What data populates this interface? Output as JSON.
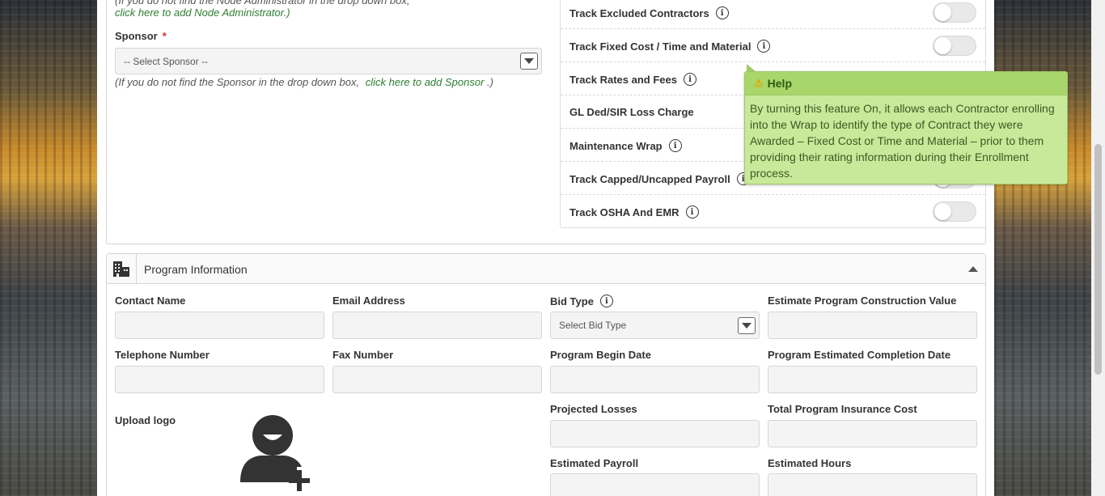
{
  "node_admin": {
    "note_partial": "(If you do not find the Node Administrator in the drop down box,",
    "link": "click here to add Node Administrator.)"
  },
  "sponsor": {
    "label": "Sponsor",
    "required_mark": "*",
    "select_value": "-- Select Sponsor --",
    "note_prefix": "(If you do not find the Sponsor in the drop down box,",
    "note_link": "click here to add Sponsor",
    "note_suffix": ".)"
  },
  "tracks": [
    {
      "label": "Track Excluded Contractors",
      "has_info": true,
      "toggle": "off"
    },
    {
      "label": "Track Fixed Cost / Time and Material",
      "has_info": true,
      "toggle": "off"
    },
    {
      "label": "Track Rates and Fees",
      "has_info": true
    },
    {
      "label": "GL Ded/SIR Loss Charge",
      "has_info": false
    },
    {
      "label": "Maintenance Wrap",
      "has_info": true
    },
    {
      "label": "Track Capped/Uncapped Payroll",
      "has_info": true,
      "toggle": "off"
    },
    {
      "label": "Track OSHA And EMR",
      "has_info": true,
      "toggle": "off"
    }
  ],
  "tooltip": {
    "title": "Help",
    "icon": "warning-icon",
    "body": "By turning this feature On, it allows each Contractor enrolling into the Wrap to identify the type of Contract they were Awarded – Fixed Cost or Time and Material – prior to them providing their rating information during their Enrollment process."
  },
  "program": {
    "title": "Program Information",
    "icon": "building-icon",
    "fields": {
      "contact_name": "Contact Name",
      "email_address": "Email Address",
      "bid_type": "Bid Type",
      "bid_type_placeholder": "Select Bid Type",
      "estimate_value": "Estimate Program Construction Value",
      "telephone": "Telephone Number",
      "fax": "Fax Number",
      "begin_date": "Program Begin Date",
      "completion_date": "Program Estimated Completion Date",
      "upload_logo": "Upload logo",
      "projected_losses": "Projected Losses",
      "total_insurance_cost": "Total Program Insurance Cost",
      "estimated_payroll": "Estimated Payroll",
      "estimated_hours": "Estimated Hours"
    }
  },
  "colors": {
    "link_green": "#2e7d32",
    "tooltip_bg": "#c9e99a",
    "tooltip_header": "#a9d66a",
    "required_red": "#d32f2f"
  }
}
